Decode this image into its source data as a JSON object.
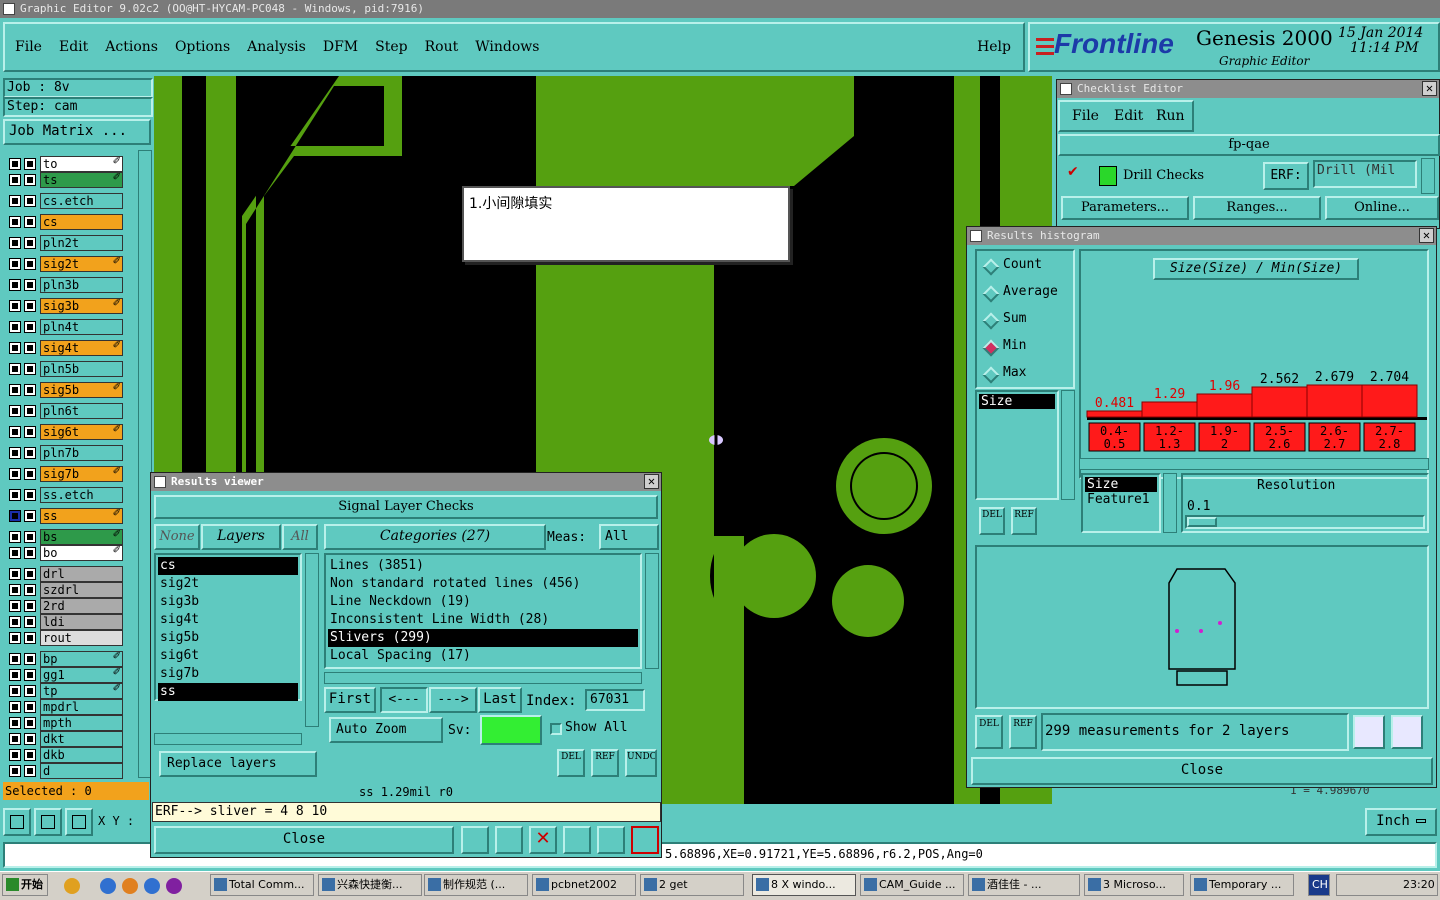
{
  "window_title": "Graphic Editor 9.02c2 (OO@HT-HYCAM-PC048 - Windows, pid:7916)",
  "menubar": [
    "File",
    "Edit",
    "Actions",
    "Options",
    "Analysis",
    "DFM",
    "Step",
    "Rout",
    "Windows"
  ],
  "help": "Help",
  "brand": {
    "logo": "Frontline",
    "product": "Genesis 2000",
    "subtitle": "Graphic Editor",
    "date": "15 Jan 2014",
    "time": "11:14 PM"
  },
  "job": {
    "job": "Job : 8v",
    "step": "Step: cam",
    "matrix": "Job Matrix ..."
  },
  "layers": [
    {
      "name": "to",
      "color": "#ffffff",
      "flag": true
    },
    {
      "name": "ts",
      "color": "#2e9a4a",
      "flag": true
    },
    {
      "name": "cs.etch",
      "color": "#5fc9c0",
      "flag": false
    },
    {
      "name": "cs",
      "color": "#f2a21c",
      "flag": false
    },
    {
      "name": "pln2t",
      "color": "#5fc9c0",
      "flag": false
    },
    {
      "name": "sig2t",
      "color": "#f2a21c",
      "flag": true
    },
    {
      "name": "pln3b",
      "color": "#5fc9c0",
      "flag": false
    },
    {
      "name": "sig3b",
      "color": "#f2a21c",
      "flag": true
    },
    {
      "name": "pln4t",
      "color": "#5fc9c0",
      "flag": false
    },
    {
      "name": "sig4t",
      "color": "#f2a21c",
      "flag": true
    },
    {
      "name": "pln5b",
      "color": "#5fc9c0",
      "flag": false
    },
    {
      "name": "sig5b",
      "color": "#f2a21c",
      "flag": true
    },
    {
      "name": "pln6t",
      "color": "#5fc9c0",
      "flag": false
    },
    {
      "name": "sig6t",
      "color": "#f2a21c",
      "flag": true
    },
    {
      "name": "pln7b",
      "color": "#5fc9c0",
      "flag": false
    },
    {
      "name": "sig7b",
      "color": "#f2a21c",
      "flag": true
    },
    {
      "name": "ss.etch",
      "color": "#5fc9c0",
      "flag": false
    },
    {
      "name": "ss",
      "color": "#f2a21c",
      "flag": true
    },
    {
      "name": "bs",
      "color": "#2e9a4a",
      "flag": true
    },
    {
      "name": "bo",
      "color": "#ffffff",
      "flag": true
    },
    {
      "name": "drl",
      "color": "#aaaaaa",
      "flag": false
    },
    {
      "name": "szdrl",
      "color": "#aaaaaa",
      "flag": false
    },
    {
      "name": "2rd",
      "color": "#aaaaaa",
      "flag": false
    },
    {
      "name": "ldi",
      "color": "#aaaaaa",
      "flag": false
    },
    {
      "name": "rout",
      "color": "#dddddd",
      "flag": false
    },
    {
      "name": "bp",
      "color": "#5fc9c0",
      "flag": true
    },
    {
      "name": "gg1",
      "color": "#5fc9c0",
      "flag": true
    },
    {
      "name": "tp",
      "color": "#5fc9c0",
      "flag": true
    },
    {
      "name": "mpdrl",
      "color": "#5fc9c0",
      "flag": false
    },
    {
      "name": "mpth",
      "color": "#5fc9c0",
      "flag": false
    },
    {
      "name": "dkt",
      "color": "#5fc9c0",
      "flag": false
    },
    {
      "name": "dkb",
      "color": "#5fc9c0",
      "flag": false
    },
    {
      "name": "d",
      "color": "#5fc9c0",
      "flag": false
    }
  ],
  "selected": "Selected : 0",
  "xy_label": "X Y :",
  "note": "1.小间隙填实",
  "results_viewer": {
    "title": "Results viewer",
    "header": "Signal Layer Checks",
    "none": "None",
    "layers": "Layers",
    "all": "All",
    "categories": "Categories (27)",
    "meas_label": "Meas:",
    "meas_value": "All",
    "layer_list": [
      "cs",
      "sig2t",
      "sig3b",
      "sig4t",
      "sig5b",
      "sig6t",
      "sig7b",
      "ss"
    ],
    "category_list": [
      "Lines (3851)",
      "Non standard rotated lines (456)",
      "Line Neckdown (19)",
      "Inconsistent Line Width (28)",
      "Slivers (299)",
      "Local Spacing (17)"
    ],
    "first": "First",
    "prev": "<---",
    "next": "--->",
    "last": "Last",
    "index_label": "Index:",
    "index_value": "67031",
    "auto_zoom": "Auto Zoom",
    "sv_label": "Sv:",
    "show_all": "Show All",
    "replace_layers": "Replace layers",
    "del": "DEL",
    "ref": "REF",
    "undo": "UNDO",
    "status": "ss 1.29mil  r0",
    "erf": "ERF--> sliver = 4 8 10",
    "close": "Close"
  },
  "checklist": {
    "title": "Checklist Editor",
    "menu": [
      "File",
      "Edit",
      "Run"
    ],
    "name": "fp-qae",
    "check": "Drill Checks",
    "erf_label": "ERF:",
    "erf_value": "Drill (Mil",
    "parameters": "Parameters...",
    "ranges": "Ranges...",
    "online": "Online..."
  },
  "histogram": {
    "title": "Results histogram",
    "modes": [
      "Count",
      "Average",
      "Sum",
      "Min",
      "Max"
    ],
    "selected_mode": "Min",
    "formula": "Size(Size) / Min(Size)",
    "list": [
      "Size"
    ],
    "bottom_list": [
      "Size",
      "Feature1"
    ],
    "resolution_label": "Resolution",
    "resolution_value": "0.1",
    "summary": "299 measurements for 2 layers",
    "del": "DEL",
    "ref": "REF",
    "close": "Close"
  },
  "chart_data": {
    "type": "bar",
    "categories": [
      "0.4-0.5",
      "1.2-1.3",
      "1.9-2",
      "2.5-2.6",
      "2.6-2.7",
      "2.7-2.8"
    ],
    "values": [
      0.481,
      1.29,
      1.96,
      2.562,
      2.679,
      2.704
    ],
    "labels": [
      "0.481",
      "1.29",
      "1.96",
      "2.562",
      "2.679",
      "2.704"
    ],
    "label_colors": [
      "#e00000",
      "#e00000",
      "#e00000",
      "#000000",
      "#000000",
      "#000000"
    ],
    "title": "Size(Size) / Min(Size)"
  },
  "units": "Inch",
  "coord_status": "5.68896,XE=0.91721,YE=5.68896,r6.2,POS,Ang=0",
  "bg_partial": "1 = 4.989670",
  "taskbar": {
    "start": "开始",
    "items": [
      "Total Comm...",
      "兴森快捷衡...",
      "制作规范 (...",
      "pcbnet2002",
      "2 get",
      "8 X windo...",
      "CAM_Guide ...",
      "酒佳佳 - ...",
      "3 Microso...",
      "Temporary ..."
    ],
    "lang": "CH",
    "clock": "23:20"
  }
}
